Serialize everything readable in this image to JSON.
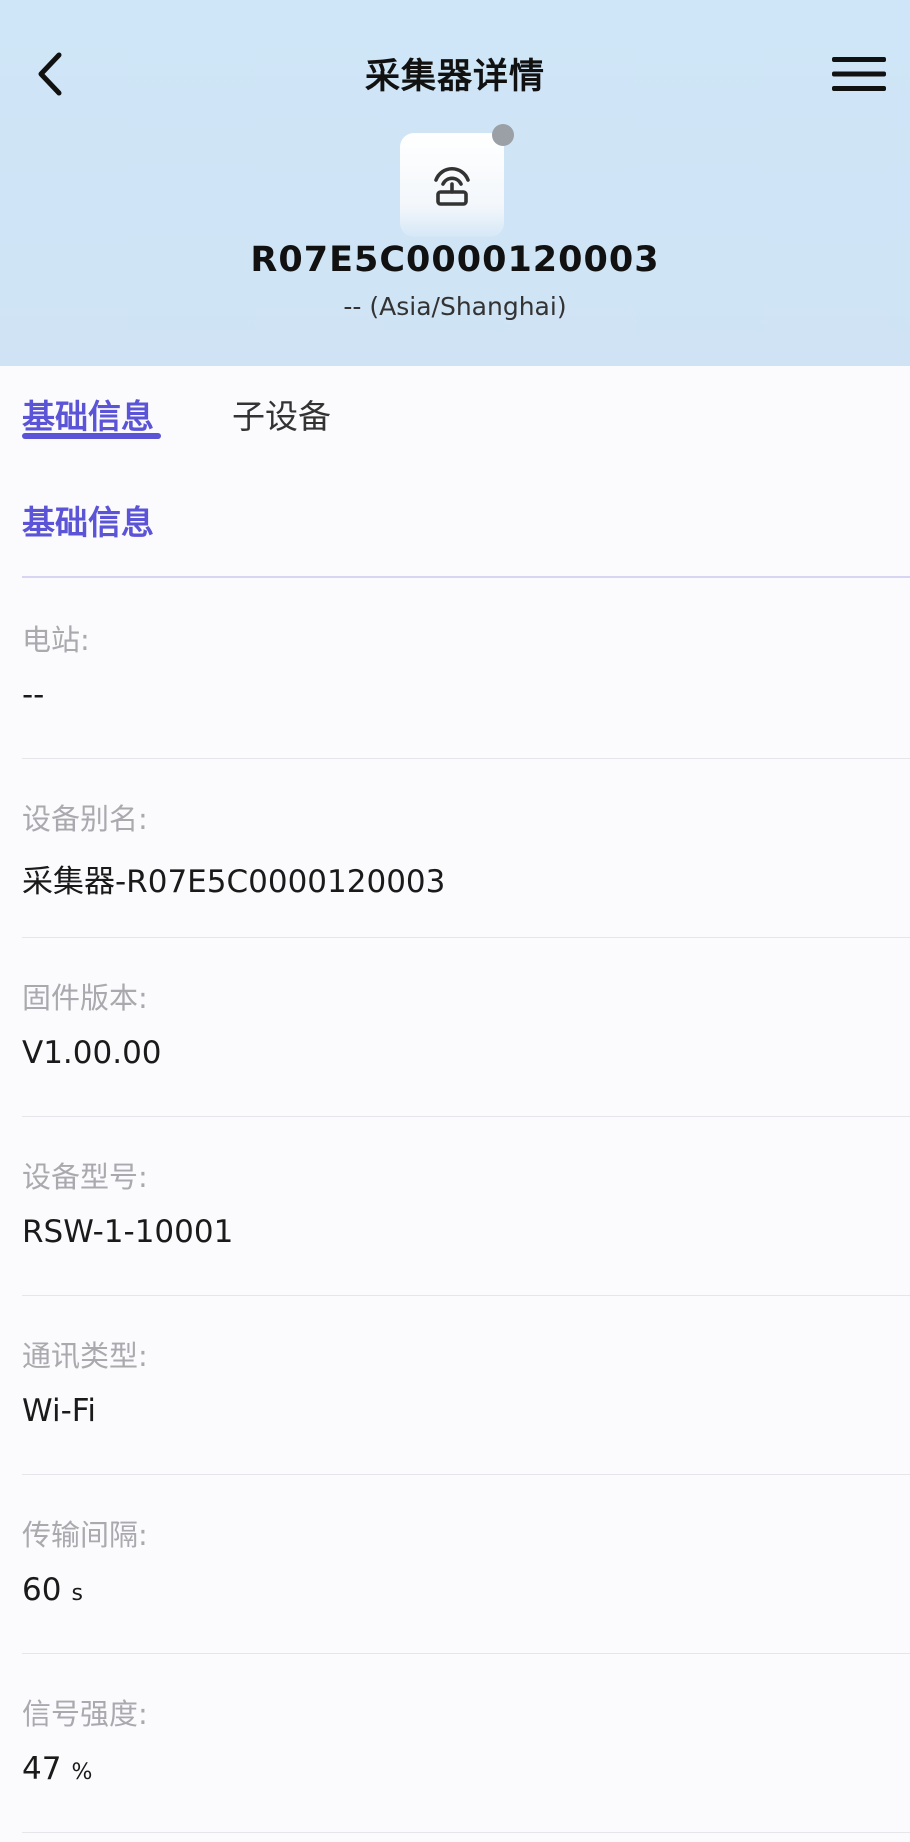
{
  "header": {
    "title": "采集器详情",
    "device_sn": "R07E5C0000120003",
    "timezone": "-- (Asia/Shanghai)",
    "status_color": "#9aa0a6",
    "accent_color": "#5b54d6",
    "background_color": "#cfe6f8",
    "back_icon": "chevron-left-icon",
    "menu_icon": "hamburger-menu-icon",
    "device_icon": "router-icon"
  },
  "tabs": [
    {
      "label": "基础信息",
      "active": true
    },
    {
      "label": "子设备",
      "active": false
    }
  ],
  "section": {
    "title": "基础信息"
  },
  "fields": [
    {
      "label": "电站:",
      "value": "--",
      "unit": ""
    },
    {
      "label": "设备别名:",
      "value": "采集器-R07E5C0000120003",
      "unit": ""
    },
    {
      "label": "固件版本:",
      "value": "V1.00.00",
      "unit": ""
    },
    {
      "label": "设备型号:",
      "value": "RSW-1-10001",
      "unit": ""
    },
    {
      "label": "通讯类型:",
      "value": "Wi-Fi",
      "unit": ""
    },
    {
      "label": "传输间隔:",
      "value": "60",
      "unit": "s"
    },
    {
      "label": "信号强度:",
      "value": "47",
      "unit": "%"
    }
  ]
}
